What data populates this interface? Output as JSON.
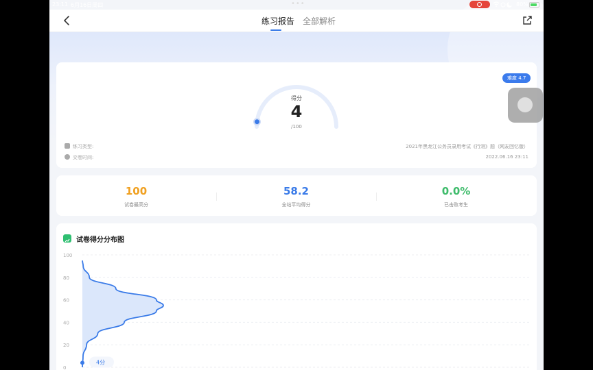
{
  "status_bar": {
    "time": "23:11",
    "date": "6月16日周四",
    "dots": "•••",
    "battery_pct": "80%"
  },
  "nav": {
    "tabs": [
      {
        "label": "练习报告",
        "active": true
      },
      {
        "label": "全部解析",
        "active": false
      }
    ]
  },
  "score_card": {
    "difficulty": "难度 4.7",
    "score_label": "得分",
    "score": "4",
    "total": "/100",
    "score_fraction": 0.04,
    "type_label": "练习类型:",
    "type_value": "2021年黑龙江公务员录用考试《行测》题（网友回忆版）",
    "time_label": "交卷时间:",
    "time_value": "2022.06.16 23:11"
  },
  "stats": [
    {
      "value": "100",
      "label": "试卷最高分",
      "color": "#f0a020"
    },
    {
      "value": "58.2",
      "label": "全站平均得分",
      "color": "#3a7be8"
    },
    {
      "value": "0.0%",
      "label": "已击败考生",
      "color": "#3dbb6a"
    }
  ],
  "distribution": {
    "title": "试卷得分分布图",
    "marker_label": "4分"
  },
  "chart_data": {
    "type": "area",
    "title": "试卷得分分布图",
    "xlabel": "",
    "ylabel": "",
    "y_ticks": [
      "100",
      "80",
      "60",
      "40",
      "20",
      "0"
    ],
    "ylim": [
      0,
      100
    ],
    "x": [
      0,
      10,
      20,
      30,
      40,
      50,
      55,
      60,
      70,
      80,
      90,
      95
    ],
    "values": [
      0.02,
      0.5,
      3,
      11,
      30,
      53,
      58,
      53,
      24,
      5,
      0.6,
      0.05
    ],
    "marker": {
      "y": 4,
      "label": "4分"
    },
    "colors": {
      "line": "#3a7be8",
      "fill": "#dbe7fb"
    }
  }
}
